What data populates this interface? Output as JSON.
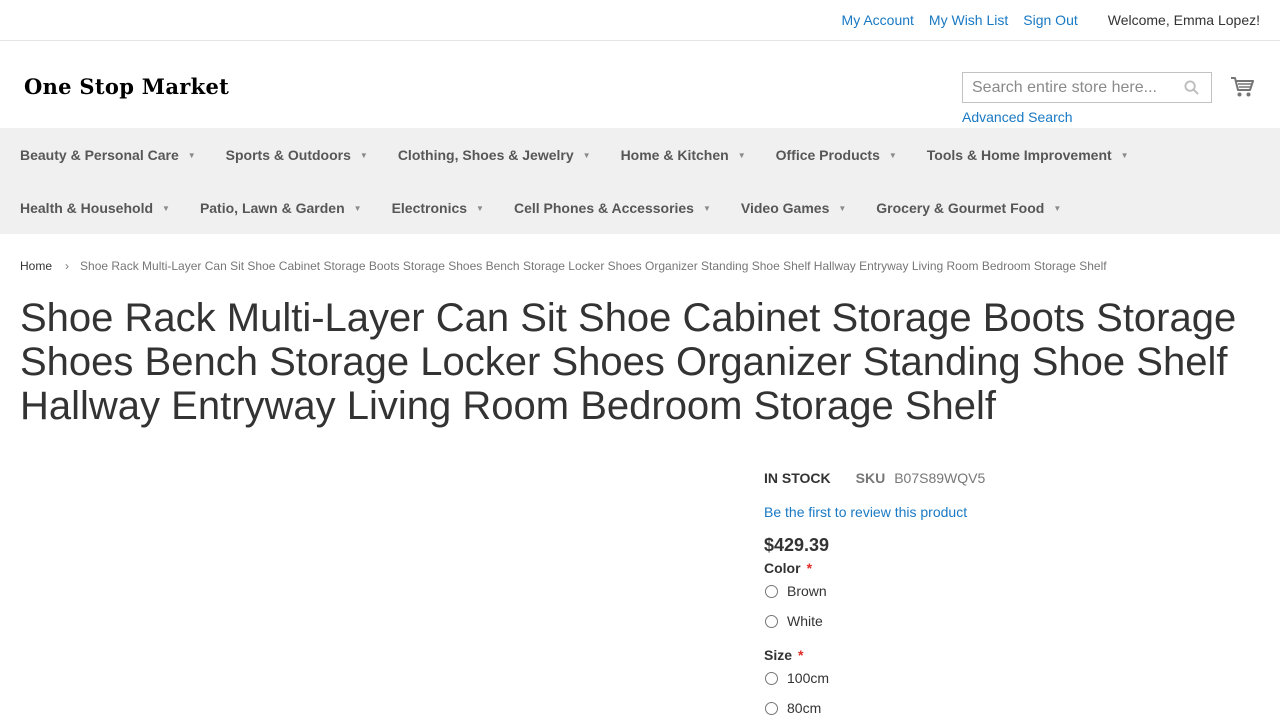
{
  "header": {
    "links": [
      "My Account",
      "My Wish List",
      "Sign Out"
    ],
    "welcome": "Welcome, Emma Lopez!"
  },
  "logo": "One Stop Market",
  "search": {
    "placeholder": "Search entire store here...",
    "advanced": "Advanced Search",
    "icons": {
      "search": "search-icon",
      "cart": "cart-icon"
    }
  },
  "nav": {
    "row1": [
      "Beauty & Personal Care",
      "Sports & Outdoors",
      "Clothing, Shoes & Jewelry",
      "Home & Kitchen",
      "Office Products",
      "Tools & Home Improvement"
    ],
    "row2": [
      "Health & Household",
      "Patio, Lawn & Garden",
      "Electronics",
      "Cell Phones & Accessories",
      "Video Games",
      "Grocery & Gourmet Food"
    ]
  },
  "breadcrumb": {
    "home": "Home",
    "current": "Shoe Rack Multi-Layer Can Sit Shoe Cabinet Storage Boots Storage Shoes Bench Storage Locker Shoes Organizer Standing Shoe Shelf Hallway Entryway Living Room Bedroom Storage Shelf"
  },
  "product": {
    "title": "Shoe Rack Multi-Layer Can Sit Shoe Cabinet Storage Boots Storage Shoes Bench Storage Locker Shoes Organizer Standing Shoe Shelf Hallway Entryway Living Room Bedroom Storage Shelf",
    "stock": "IN STOCK",
    "sku_label": "SKU",
    "sku": "B07S89WQV5",
    "review_link": "Be the first to review this product",
    "price": "$429.39",
    "color_label": "Color",
    "required_mark": "*",
    "colors": [
      "Brown",
      "White"
    ],
    "size_label": "Size",
    "sizes": [
      "100cm",
      "80cm"
    ]
  }
}
